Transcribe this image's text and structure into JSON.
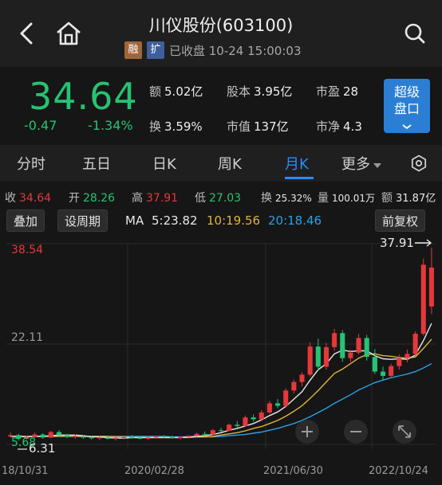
{
  "header": {
    "title": "川仪股份(603100)",
    "tag_rong": "融",
    "tag_kuo": "扩",
    "status": "已收盘 10-24 15:00:03"
  },
  "quote": {
    "price": "34.64",
    "change": "-0.47",
    "change_pct": "-1.34%",
    "amount_label": "额",
    "amount": "5.02亿",
    "turnover_label": "换",
    "turnover": "3.59%",
    "equity_label": "股本",
    "equity": "3.95亿",
    "mktcap_label": "市值",
    "mktcap": "137亿",
    "pe_label": "市盈",
    "pe": "28",
    "pb_label": "市净",
    "pb": "4.3",
    "super_btn_line1": "超级",
    "super_btn_line2": "盘口"
  },
  "tabs": [
    "分时",
    "五日",
    "日K",
    "周K",
    "月K",
    "更多"
  ],
  "active_tab": "月K",
  "stats": {
    "close_label": "收",
    "close": "34.64",
    "open_label": "开",
    "open": "28.26",
    "high_label": "高",
    "high": "37.91",
    "low_label": "低",
    "low": "27.03",
    "turn_label": "换",
    "turn": "25.32%",
    "vol_label": "量",
    "vol": "100.01万",
    "amt_label": "额",
    "amt": "31.87亿"
  },
  "controls": {
    "overlay_btn": "叠加",
    "period_btn": "设周期",
    "ma_label": "MA",
    "ma5": "5:23.82",
    "ma10": "10:19.56",
    "ma20": "20:18.46",
    "adjust_btn": "前复权"
  },
  "chart_data": {
    "type": "candlestick",
    "y_top_label": "38.54",
    "y_mid_label": "22.11",
    "y_bottom_label": "5.68",
    "max_marker": "37.91",
    "min_marker": "6.31",
    "x_labels": [
      "18/10/31",
      "2020/02/28",
      "2021/06/30",
      "2022/10/24"
    ],
    "ylim": [
      5.68,
      38.54
    ],
    "colors": {
      "up": "#e5383b",
      "down": "#27c274",
      "ma5": "#e5e5e5",
      "ma10": "#e0b43a",
      "ma20": "#2aa0e8"
    },
    "candles": [
      [
        7.0,
        7.6,
        6.8,
        7.2
      ],
      [
        7.2,
        7.4,
        6.3,
        6.6
      ],
      [
        6.6,
        7.1,
        6.4,
        6.9
      ],
      [
        6.9,
        7.6,
        6.7,
        7.3
      ],
      [
        7.3,
        7.5,
        6.6,
        6.8
      ],
      [
        6.8,
        7.9,
        6.7,
        7.7
      ],
      [
        7.7,
        8.0,
        7.0,
        7.2
      ],
      [
        7.2,
        7.4,
        6.7,
        6.9
      ],
      [
        6.9,
        7.3,
        6.6,
        7.0
      ],
      [
        7.0,
        7.2,
        6.6,
        6.8
      ],
      [
        6.8,
        7.1,
        6.5,
        6.7
      ],
      [
        6.7,
        7.0,
        6.4,
        6.8
      ],
      [
        6.8,
        7.0,
        6.5,
        6.6
      ],
      [
        6.6,
        6.9,
        6.3,
        6.7
      ],
      [
        6.7,
        7.0,
        6.5,
        6.9
      ],
      [
        6.9,
        7.2,
        6.6,
        6.8
      ],
      [
        6.8,
        7.0,
        6.5,
        6.6
      ],
      [
        6.6,
        6.9,
        6.4,
        6.8
      ],
      [
        6.8,
        7.1,
        6.6,
        7.0
      ],
      [
        7.0,
        7.2,
        6.7,
        6.9
      ],
      [
        6.9,
        7.1,
        6.6,
        6.7
      ],
      [
        6.7,
        7.0,
        6.5,
        6.9
      ],
      [
        6.9,
        7.2,
        6.8,
        7.1
      ],
      [
        7.1,
        7.6,
        7.0,
        7.4
      ],
      [
        7.4,
        7.8,
        7.1,
        7.3
      ],
      [
        7.3,
        8.2,
        7.2,
        8.0
      ],
      [
        8.0,
        8.4,
        7.7,
        7.9
      ],
      [
        7.9,
        9.1,
        7.8,
        8.9
      ],
      [
        8.9,
        9.5,
        8.4,
        8.7
      ],
      [
        8.7,
        10.4,
        8.6,
        10.1
      ],
      [
        10.1,
        10.6,
        9.4,
        9.8
      ],
      [
        9.8,
        11.3,
        9.6,
        10.9
      ],
      [
        10.9,
        12.8,
        10.7,
        12.4
      ],
      [
        12.4,
        13.1,
        11.6,
        12.0
      ],
      [
        12.0,
        14.9,
        11.8,
        14.5
      ],
      [
        14.5,
        16.3,
        14.0,
        15.9
      ],
      [
        15.9,
        17.5,
        15.2,
        17.1
      ],
      [
        17.1,
        22.4,
        16.8,
        21.7
      ],
      [
        21.7,
        23.0,
        17.8,
        18.4
      ],
      [
        18.4,
        22.3,
        17.9,
        21.6
      ],
      [
        21.6,
        24.6,
        21.0,
        23.9
      ],
      [
        23.9,
        24.4,
        19.2,
        19.8
      ],
      [
        19.8,
        21.2,
        19.2,
        20.7
      ],
      [
        20.7,
        23.8,
        20.4,
        23.1
      ],
      [
        23.1,
        23.6,
        19.4,
        20.0
      ],
      [
        20.0,
        21.3,
        17.2,
        17.6
      ],
      [
        17.6,
        18.4,
        16.2,
        16.9
      ],
      [
        16.9,
        18.9,
        16.6,
        18.5
      ],
      [
        18.5,
        20.4,
        17.9,
        19.8
      ],
      [
        19.8,
        21.2,
        19.1,
        20.5
      ],
      [
        20.5,
        24.2,
        20.2,
        23.8
      ],
      [
        23.8,
        36.1,
        23.5,
        35.1
      ],
      [
        28.26,
        37.91,
        27.03,
        34.64
      ]
    ],
    "ma5": [
      7.0,
      7.0,
      6.9,
      7.0,
      7.0,
      7.1,
      7.2,
      7.2,
      7.2,
      7.1,
      6.9,
      6.9,
      6.8,
      6.7,
      6.7,
      6.8,
      6.8,
      6.8,
      6.8,
      6.8,
      6.8,
      6.8,
      6.9,
      7.0,
      7.1,
      7.3,
      7.6,
      8.0,
      8.3,
      8.7,
      9.1,
      9.7,
      10.4,
      11.0,
      11.9,
      13.1,
      14.3,
      16.2,
      17.9,
      18.9,
      20.5,
      21.1,
      20.9,
      21.0,
      21.0,
      20.2,
      19.7,
      19.6,
      19.7,
      19.6,
      20.3,
      22.7,
      25.5
    ],
    "ma10": [
      7.0,
      7.0,
      7.0,
      7.0,
      7.0,
      7.0,
      7.0,
      7.0,
      7.0,
      7.0,
      7.0,
      7.0,
      7.0,
      6.9,
      6.9,
      6.8,
      6.8,
      6.8,
      6.8,
      6.8,
      6.8,
      6.8,
      6.8,
      6.9,
      6.9,
      7.0,
      7.2,
      7.4,
      7.6,
      7.9,
      8.3,
      8.6,
      9.1,
      9.6,
      10.3,
      11.1,
      12.0,
      13.2,
      14.5,
      15.9,
      17.3,
      18.0,
      18.9,
      19.8,
      20.4,
      20.5,
      20.2,
      20.1,
      19.9,
      19.8,
      20.0,
      21.4,
      22.9
    ],
    "ma20": [
      7.0,
      7.0,
      7.0,
      7.0,
      7.0,
      7.0,
      7.0,
      7.0,
      7.0,
      7.0,
      7.0,
      7.0,
      7.0,
      7.0,
      7.0,
      7.0,
      7.0,
      7.0,
      7.0,
      7.0,
      6.9,
      6.9,
      6.9,
      6.9,
      6.9,
      6.9,
      7.0,
      7.1,
      7.2,
      7.3,
      7.5,
      7.7,
      8.0,
      8.3,
      8.7,
      9.1,
      9.6,
      10.2,
      10.9,
      11.6,
      12.4,
      13.1,
      13.8,
      14.6,
      15.2,
      15.8,
      16.2,
      16.6,
      16.9,
      17.2,
      17.6,
      18.2,
      18.9
    ]
  }
}
